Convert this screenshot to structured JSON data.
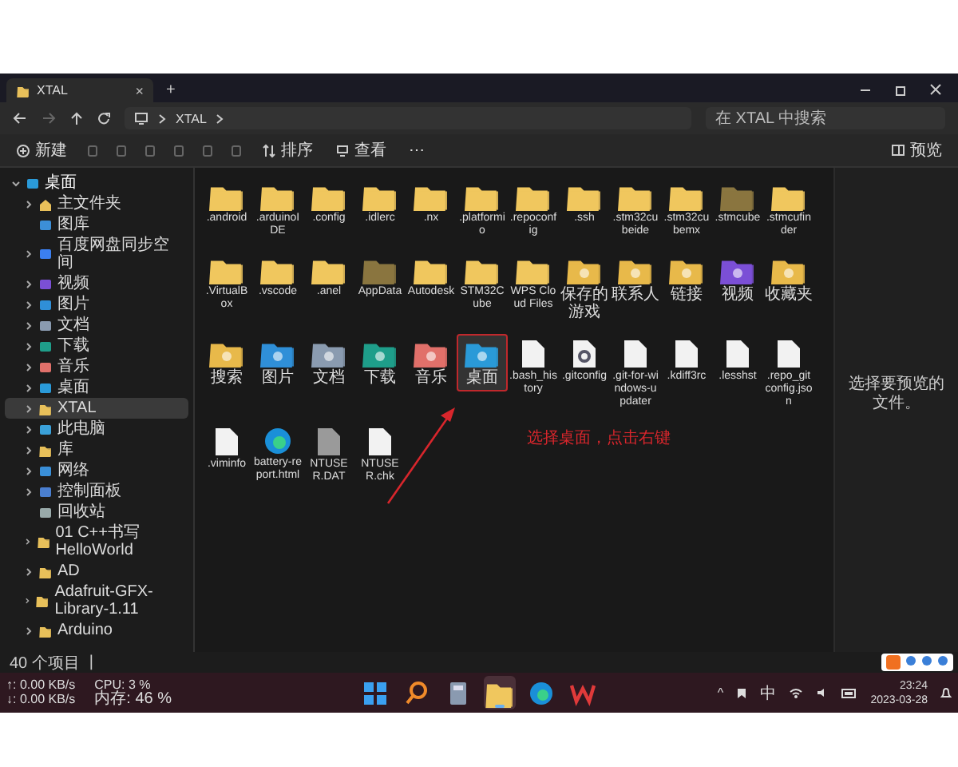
{
  "window": {
    "tab_title": "XTAL",
    "tab_close": "×",
    "new_tab": "+"
  },
  "address": {
    "path": [
      "XTAL"
    ],
    "search_placeholder": "在 XTAL 中搜索"
  },
  "toolbar": {
    "new_label": "新建",
    "sort_label": "排序",
    "view_label": "查看",
    "more": "⋯",
    "preview_label": "预览"
  },
  "sidebar": {
    "items": [
      {
        "label": "桌面",
        "kind": "desktop",
        "expanded": true,
        "selected": false,
        "children": [
          {
            "label": "主文件夹",
            "kind": "home",
            "expanded": false,
            "selected": false
          },
          {
            "label": "图库",
            "kind": "gallery",
            "selected": false
          },
          {
            "label": "百度网盘同步空间",
            "kind": "cloud",
            "expanded": false,
            "selected": false
          },
          {
            "label": "视频",
            "kind": "video",
            "expanded": false,
            "selected": false
          },
          {
            "label": "图片",
            "kind": "picture",
            "expanded": false,
            "selected": false
          },
          {
            "label": "文档",
            "kind": "document",
            "expanded": false,
            "selected": false
          },
          {
            "label": "下载",
            "kind": "download",
            "expanded": false,
            "selected": false
          },
          {
            "label": "音乐",
            "kind": "music",
            "expanded": false,
            "selected": false
          },
          {
            "label": "桌面",
            "kind": "desktop",
            "expanded": false,
            "selected": false
          },
          {
            "label": "XTAL",
            "kind": "folder",
            "expanded": false,
            "selected": true
          },
          {
            "label": "此电脑",
            "kind": "pc",
            "expanded": false,
            "selected": false
          },
          {
            "label": "库",
            "kind": "folder",
            "expanded": false,
            "selected": false
          },
          {
            "label": "网络",
            "kind": "network",
            "expanded": false,
            "selected": false
          },
          {
            "label": "控制面板",
            "kind": "control-panel",
            "expanded": false,
            "selected": false
          },
          {
            "label": "回收站",
            "kind": "recycle-bin",
            "selected": false
          },
          {
            "label": "01 C++书写HelloWorld",
            "kind": "folder",
            "expanded": false,
            "selected": false
          },
          {
            "label": "AD",
            "kind": "folder",
            "expanded": false,
            "selected": false
          },
          {
            "label": "Adafruit-GFX-Library-1.11",
            "kind": "folder",
            "expanded": false,
            "selected": false
          },
          {
            "label": "Arduino",
            "kind": "folder",
            "expanded": false,
            "selected": false
          }
        ]
      }
    ]
  },
  "files": [
    {
      "name": ".android",
      "kind": "folder",
      "selected": false,
      "annotated": false
    },
    {
      "name": ".arduinoIDE",
      "kind": "folder",
      "selected": false,
      "annotated": false
    },
    {
      "name": ".config",
      "kind": "folder",
      "selected": false,
      "annotated": false
    },
    {
      "name": ".idlerc",
      "kind": "folder",
      "selected": false,
      "annotated": false
    },
    {
      "name": ".nx",
      "kind": "folder",
      "selected": false,
      "annotated": false
    },
    {
      "name": ".platformio",
      "kind": "folder",
      "selected": false,
      "annotated": false
    },
    {
      "name": ".repoconfig",
      "kind": "folder",
      "selected": false,
      "annotated": false
    },
    {
      "name": ".ssh",
      "kind": "folder",
      "selected": false,
      "annotated": false
    },
    {
      "name": ".stm32cubeide",
      "kind": "folder",
      "selected": false,
      "annotated": false
    },
    {
      "name": ".stm32cubemx",
      "kind": "folder",
      "selected": false,
      "annotated": false
    },
    {
      "name": ".stmcube",
      "kind": "dim-folder",
      "selected": false,
      "annotated": false
    },
    {
      "name": ".stmcufinder",
      "kind": "folder",
      "selected": false,
      "annotated": false
    },
    {
      "name": ".VirtualBox",
      "kind": "folder",
      "selected": false,
      "annotated": false
    },
    {
      "name": ".vscode",
      "kind": "folder",
      "selected": false,
      "annotated": false
    },
    {
      "name": ".anel",
      "kind": "folder",
      "selected": false,
      "annotated": false
    },
    {
      "name": "AppData",
      "kind": "dim-folder",
      "selected": false,
      "annotated": false
    },
    {
      "name": "Autodesk",
      "kind": "folder",
      "selected": false,
      "annotated": false
    },
    {
      "name": "STM32Cube",
      "kind": "folder",
      "selected": false,
      "annotated": false
    },
    {
      "name": "WPS Cloud Files",
      "kind": "folder",
      "selected": false,
      "annotated": false
    },
    {
      "name": "保存的游戏",
      "kind": "system-folder",
      "color": "#e8b84a",
      "selected": false,
      "annotated": false
    },
    {
      "name": "联系人",
      "kind": "system-folder",
      "color": "#e8b84a",
      "selected": false,
      "annotated": false
    },
    {
      "name": "链接",
      "kind": "system-folder",
      "color": "#e8b84a",
      "selected": false,
      "annotated": false
    },
    {
      "name": "视频",
      "kind": "system-folder",
      "color": "#7b4fd6",
      "selected": false,
      "annotated": false
    },
    {
      "name": "收藏夹",
      "kind": "system-folder",
      "color": "#e8b84a",
      "selected": false,
      "annotated": false
    },
    {
      "name": "搜索",
      "kind": "system-folder",
      "color": "#e8b84a",
      "selected": false,
      "annotated": false
    },
    {
      "name": "图片",
      "kind": "system-folder",
      "color": "#2f8fd8",
      "selected": false,
      "annotated": false
    },
    {
      "name": "文档",
      "kind": "system-folder",
      "color": "#8a9bb0",
      "selected": false,
      "annotated": false
    },
    {
      "name": "下载",
      "kind": "system-folder",
      "color": "#1f9e8a",
      "selected": false,
      "annotated": false
    },
    {
      "name": "音乐",
      "kind": "system-folder",
      "color": "#e0706a",
      "selected": false,
      "annotated": false
    },
    {
      "name": "桌面",
      "kind": "system-folder",
      "color": "#2a9ad8",
      "selected": true,
      "annotated": true
    },
    {
      "name": ".bash_history",
      "kind": "file",
      "selected": false,
      "annotated": false
    },
    {
      "name": ".gitconfig",
      "kind": "config-file",
      "selected": false,
      "annotated": false
    },
    {
      "name": ".git-for-windows-updater",
      "kind": "file",
      "selected": false,
      "annotated": false
    },
    {
      "name": ".kdiff3rc",
      "kind": "file",
      "selected": false,
      "annotated": false
    },
    {
      "name": ".lesshst",
      "kind": "file",
      "selected": false,
      "annotated": false
    },
    {
      "name": ".repo_gitconfig.json",
      "kind": "file",
      "selected": false,
      "annotated": false
    },
    {
      "name": ".viminfo",
      "kind": "file",
      "selected": false,
      "annotated": false
    },
    {
      "name": "battery-report.html",
      "kind": "browser-file",
      "selected": false,
      "annotated": false
    },
    {
      "name": "NTUSER.DAT",
      "kind": "system-file",
      "selected": false,
      "annotated": false
    },
    {
      "name": "NTUSER.chk",
      "kind": "file",
      "selected": false,
      "annotated": false
    }
  ],
  "annotation": {
    "text": "选择桌面，点击右键"
  },
  "preview": {
    "message": "选择要预览的文件。"
  },
  "status_bar": {
    "count": "40 个项目",
    "separator": "|"
  },
  "taskbar": {
    "net_up": "↑: 0.00 KB/s",
    "net_down": "↓: 0.00 KB/s",
    "cpu": "CPU: 3 %",
    "memory": "内存: 46 %",
    "apps": [
      {
        "kind": "start",
        "active": false
      },
      {
        "kind": "search",
        "active": false
      },
      {
        "kind": "calculator",
        "active": false
      },
      {
        "kind": "explorer",
        "active": true
      },
      {
        "kind": "browser",
        "active": false
      },
      {
        "kind": "office",
        "active": false
      }
    ],
    "tray_chevron": "^",
    "ime": "中",
    "time": "23:24",
    "date": "2023-03-28"
  }
}
